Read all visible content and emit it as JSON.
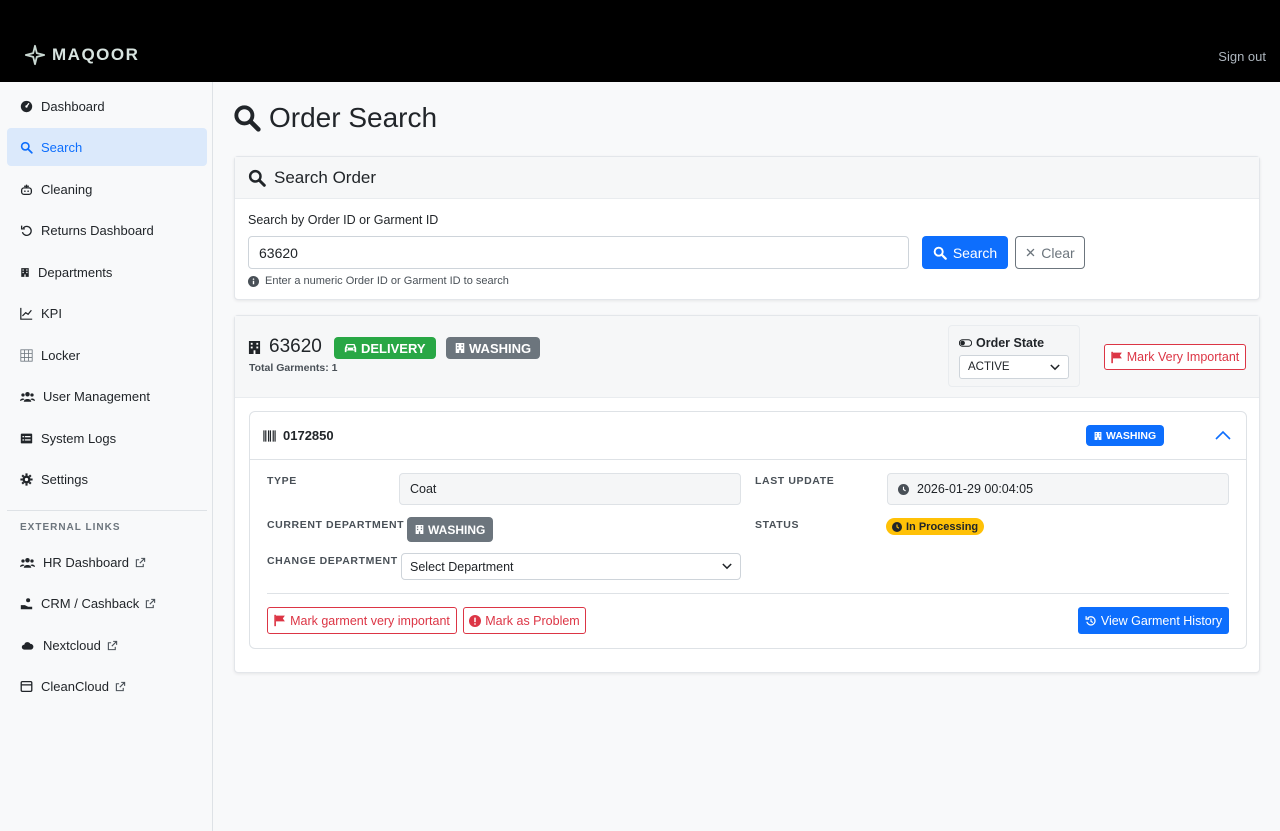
{
  "header": {
    "brand": "MAQOOR",
    "signout_label": "Sign out"
  },
  "sidebar": {
    "items": [
      {
        "label": "Dashboard",
        "icon": "dashboard-icon",
        "active": false
      },
      {
        "label": "Search",
        "icon": "search-icon",
        "active": true
      },
      {
        "label": "Cleaning",
        "icon": "cleaning-icon",
        "active": false
      },
      {
        "label": "Returns Dashboard",
        "icon": "undo-icon",
        "active": false
      },
      {
        "label": "Departments",
        "icon": "building-icon",
        "active": false
      },
      {
        "label": "KPI",
        "icon": "line-chart-icon",
        "active": false
      },
      {
        "label": "Locker",
        "icon": "grid-icon",
        "active": false
      },
      {
        "label": "User Management",
        "icon": "users-icon",
        "active": false
      },
      {
        "label": "System Logs",
        "icon": "list-icon",
        "active": false
      },
      {
        "label": "Settings",
        "icon": "gear-icon",
        "active": false
      }
    ],
    "external_heading": "EXTERNAL LINKS",
    "external": [
      {
        "label": "HR Dashboard",
        "icon": "users-icon"
      },
      {
        "label": "CRM / Cashback",
        "icon": "hand-coin-icon"
      },
      {
        "label": "Nextcloud",
        "icon": "cloud-icon"
      },
      {
        "label": "CleanCloud",
        "icon": "store-icon"
      }
    ]
  },
  "page": {
    "title": "Order Search"
  },
  "search": {
    "card_title": "Search Order",
    "field_label": "Search by Order ID or Garment ID",
    "value": "63620",
    "search_label": "Search",
    "clear_label": "Clear",
    "hint": "Enter a numeric Order ID or Garment ID to search"
  },
  "order": {
    "id": "63620",
    "delivery_badge": "DELIVERY",
    "dept_badge": "WASHING",
    "total_garments": "Total Garments: 1",
    "state_label": "Order State",
    "state_value": "ACTIVE",
    "mark_very_important": "Mark Very Important"
  },
  "garment": {
    "id": "0172850",
    "dept_badge": "WASHING",
    "type_label": "TYPE",
    "type_value": "Coat",
    "last_update_label": "LAST UPDATE",
    "last_update_value": "2026-01-29 00:04:05",
    "current_dept_label": "CURRENT DEPARTMENT",
    "current_dept_value": "WASHING",
    "status_label": "STATUS",
    "status_value": "In Processing",
    "change_dept_label": "CHANGE DEPARTMENT",
    "change_dept_placeholder": "Select Department",
    "mark_important_label": "Mark garment very important",
    "mark_problem_label": "Mark as Problem",
    "history_label": "View Garment History"
  },
  "colors": {
    "primary": "#0d6efd",
    "success": "#28a745",
    "secondary": "#6c757d",
    "danger": "#dc3545",
    "warning": "#ffc107"
  }
}
